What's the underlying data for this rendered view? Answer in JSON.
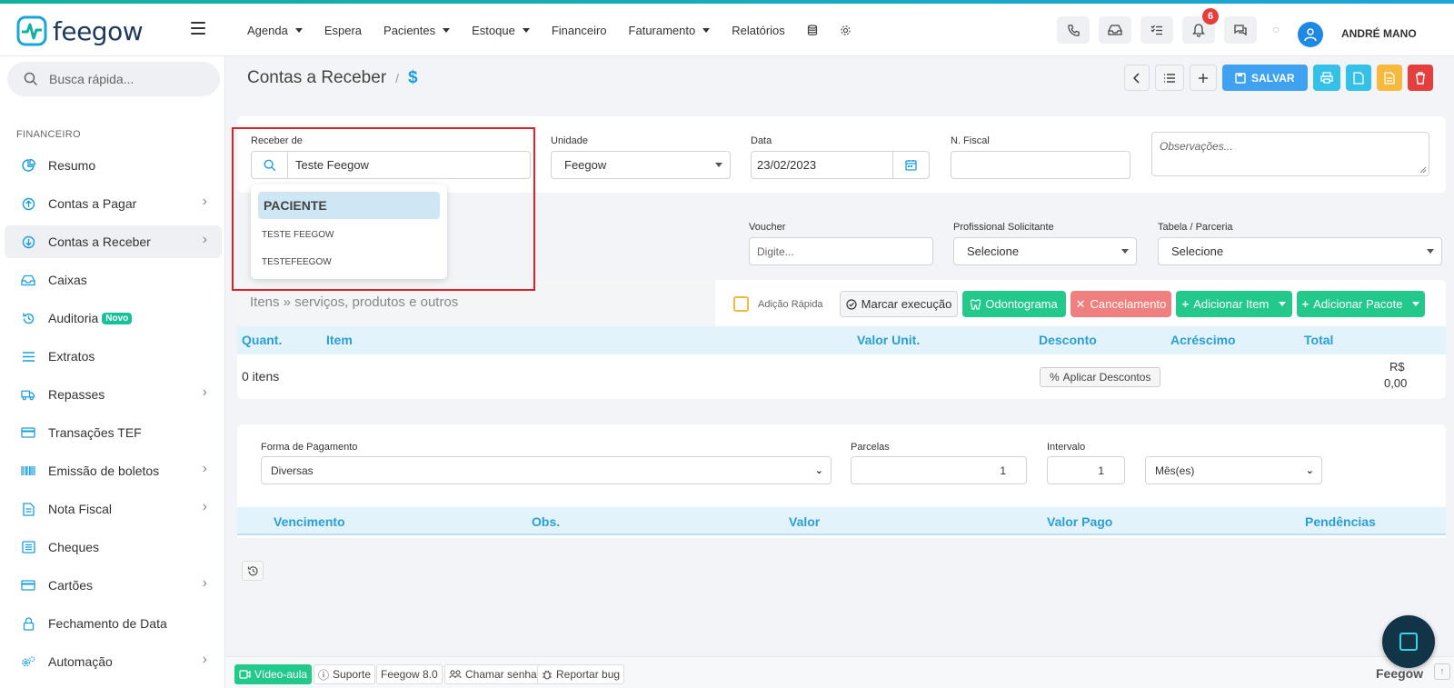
{
  "brand": {
    "name": "feegow"
  },
  "nav": {
    "items": [
      {
        "label": "Agenda",
        "caret": true
      },
      {
        "label": "Espera",
        "caret": false
      },
      {
        "label": "Pacientes",
        "caret": true
      },
      {
        "label": "Estoque",
        "caret": true
      },
      {
        "label": "Financeiro",
        "caret": false
      },
      {
        "label": "Faturamento",
        "caret": true
      },
      {
        "label": "Relatórios",
        "caret": false
      }
    ],
    "notifications_count": "6",
    "user_name": "ANDRÉ MANO"
  },
  "sidebar": {
    "search_placeholder": "Busca rápida...",
    "section_label": "FINANCEIRO",
    "items": [
      {
        "label": "Resumo",
        "icon": "pie-chart-icon",
        "chevron": false
      },
      {
        "label": "Contas a Pagar",
        "icon": "arrow-up-circle-icon",
        "chevron": true
      },
      {
        "label": "Contas a Receber",
        "icon": "arrow-down-circle-icon",
        "chevron": true
      },
      {
        "label": "Caixas",
        "icon": "inbox-icon",
        "chevron": false
      },
      {
        "label": "Auditoria",
        "icon": "history-icon",
        "chevron": false,
        "badge": "Novo"
      },
      {
        "label": "Extratos",
        "icon": "list-icon",
        "chevron": false
      },
      {
        "label": "Repasses",
        "icon": "truck-icon",
        "chevron": true
      },
      {
        "label": "Transações TEF",
        "icon": "credit-card-icon",
        "chevron": false
      },
      {
        "label": "Emissão de boletos",
        "icon": "barcode-icon",
        "chevron": true
      },
      {
        "label": "Nota Fiscal",
        "icon": "document-icon",
        "chevron": true
      },
      {
        "label": "Cheques",
        "icon": "cheque-icon",
        "chevron": false
      },
      {
        "label": "Cartões",
        "icon": "card-icon",
        "chevron": true
      },
      {
        "label": "Fechamento de Data",
        "icon": "lock-icon",
        "chevron": false
      },
      {
        "label": "Automação",
        "icon": "gears-icon",
        "chevron": true
      }
    ]
  },
  "header": {
    "title": "Contas a Receber",
    "separator": "/",
    "currency_symbol": "$",
    "save_label": "SALVAR"
  },
  "form": {
    "receber_label": "Receber de",
    "receber_value": "Teste Feegow",
    "unidade_label": "Unidade",
    "unidade_value": "Feegow",
    "data_label": "Data",
    "data_value": "23/02/2023",
    "nfiscal_label": "N. Fiscal",
    "nfiscal_value": "",
    "obs_placeholder": "Observações...",
    "voucher_label": "Voucher",
    "voucher_placeholder": "Digite...",
    "prof_label": "Profissional Solicitante",
    "prof_value": "Selecione",
    "tabela_label": "Tabela / Parceria",
    "tabela_value": "Selecione"
  },
  "dropdown": {
    "header": "PACIENTE",
    "options": [
      "TESTE FEEGOW",
      "TESTEFEEGOW"
    ]
  },
  "items": {
    "title": "Itens » serviços, produtos e outros",
    "quick_add": "Adição Rápida",
    "mark_exec": "Marcar execução",
    "odontograma": "Odontograma",
    "cancelamento": "Cancelamento",
    "add_item": "Adicionar Item",
    "add_pacote": "Adicionar Pacote",
    "columns": [
      "Quant.",
      "Item",
      "Valor Unit.",
      "Desconto",
      "Acréscimo",
      "Total"
    ],
    "count_text": "0 itens",
    "apply_discounts": "Aplicar Descontos",
    "total_currency": "R$",
    "total_value": "0,00"
  },
  "payment": {
    "forma_label": "Forma de Pagamento",
    "forma_value": "Diversas",
    "parcelas_label": "Parcelas",
    "parcelas_value": "1",
    "intervalo_label": "Intervalo",
    "intervalo_value": "1",
    "periodo_value": "Mês(es)",
    "columns": [
      "Vencimento",
      "Obs.",
      "Valor",
      "Valor Pago",
      "Pendências"
    ]
  },
  "footer": {
    "video": "Vídeo-aula",
    "suporte": "Suporte",
    "version": "Feegow 8.0",
    "chamar": "Chamar senha",
    "bug": "Reportar bug",
    "brand": "Feegow"
  },
  "colors": {
    "accent_blue": "#3ea2f0",
    "green": "#22c98a",
    "red": "#e53e3e",
    "highlight_box": "#e01f26"
  }
}
